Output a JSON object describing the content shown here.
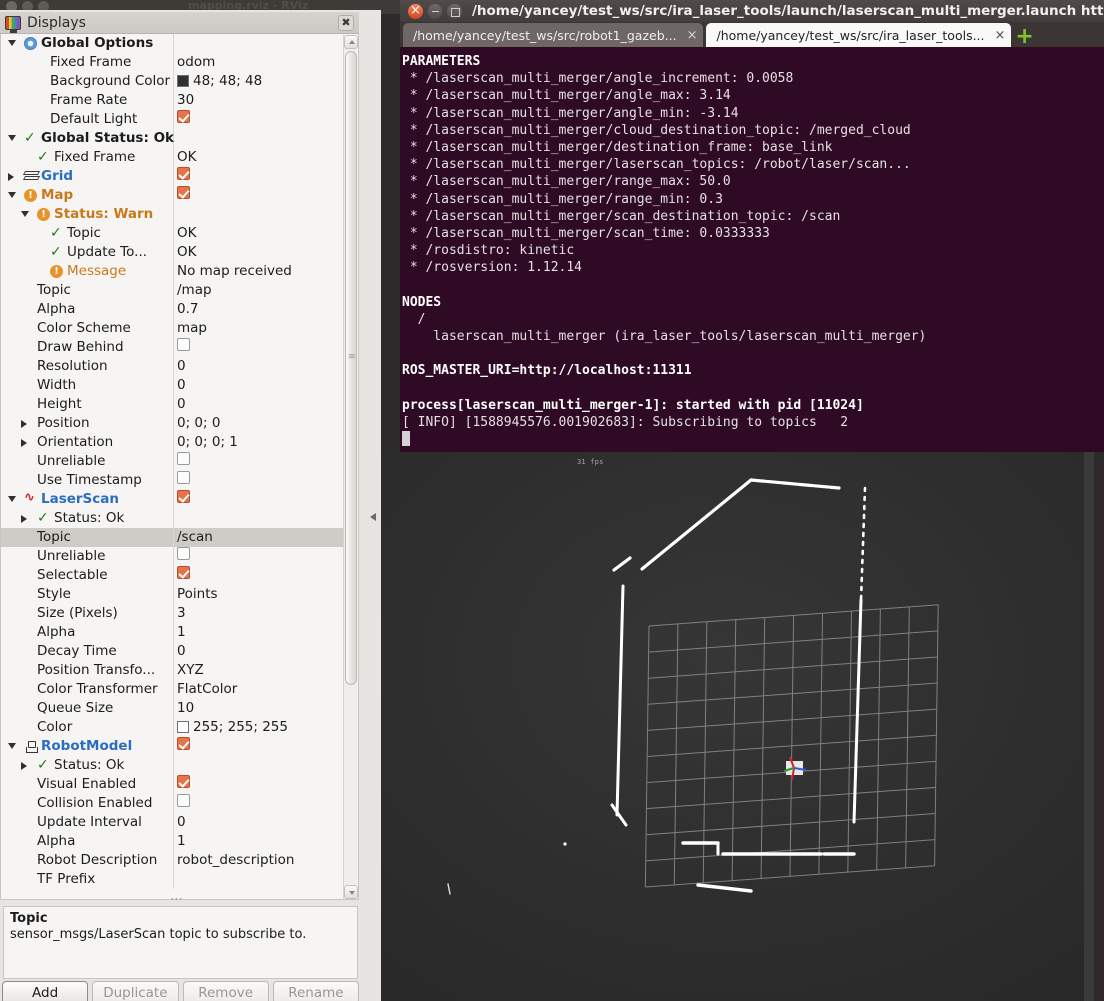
{
  "desktop": {
    "rviz_window_title": "mapping.rviz - RViz"
  },
  "rviz": {
    "dock": {
      "title": "Displays",
      "icon": "displays-icon",
      "close_label": "✖"
    },
    "tree_rows": [
      {
        "indent": 1,
        "arrow": "down",
        "icon": "gear",
        "name": "Global Options",
        "value": "",
        "bold": true,
        "color": "normal"
      },
      {
        "indent": 3,
        "arrow": "",
        "icon": "",
        "name": "Fixed Frame",
        "value": "odom",
        "bold": false,
        "color": "normal"
      },
      {
        "indent": 3,
        "arrow": "",
        "icon": "",
        "name": "Background Color",
        "value": "48; 48; 48",
        "bold": false,
        "color": "normal",
        "swatch": "dark"
      },
      {
        "indent": 3,
        "arrow": "",
        "icon": "",
        "name": "Frame Rate",
        "value": "30",
        "bold": false,
        "color": "normal"
      },
      {
        "indent": 3,
        "arrow": "",
        "icon": "",
        "name": "Default Light",
        "value": "",
        "bold": false,
        "color": "normal",
        "check": "on"
      },
      {
        "indent": 1,
        "arrow": "down",
        "icon": "tick",
        "name": "Global Status: Ok",
        "value": "",
        "bold": true,
        "color": "normal"
      },
      {
        "indent": 2,
        "arrow": "",
        "icon": "tick",
        "name": "Fixed Frame",
        "value": "OK",
        "bold": false,
        "color": "normal"
      },
      {
        "indent": 1,
        "arrow": "right",
        "icon": "grid",
        "name": "Grid",
        "value": "",
        "bold": true,
        "color": "blue",
        "check": "on"
      },
      {
        "indent": 1,
        "arrow": "down",
        "icon": "warn",
        "name": "Map",
        "value": "",
        "bold": true,
        "color": "orange",
        "check": "on"
      },
      {
        "indent": 2,
        "arrow": "down",
        "icon": "warn",
        "name": "Status: Warn",
        "value": "",
        "bold": false,
        "color": "orange"
      },
      {
        "indent": 3,
        "arrow": "",
        "icon": "tick",
        "name": "Topic",
        "value": "OK",
        "bold": false,
        "color": "normal"
      },
      {
        "indent": 3,
        "arrow": "",
        "icon": "tick",
        "name": "Update To...",
        "value": "OK",
        "bold": false,
        "color": "normal"
      },
      {
        "indent": 3,
        "arrow": "",
        "icon": "warn",
        "name": "Message",
        "value": "No map received",
        "bold": false,
        "color": "orangeN"
      },
      {
        "indent": 2,
        "arrow": "",
        "icon": "",
        "name": "Topic",
        "value": "/map",
        "bold": false,
        "color": "normal"
      },
      {
        "indent": 2,
        "arrow": "",
        "icon": "",
        "name": "Alpha",
        "value": "0.7",
        "bold": false,
        "color": "normal"
      },
      {
        "indent": 2,
        "arrow": "",
        "icon": "",
        "name": "Color Scheme",
        "value": "map",
        "bold": false,
        "color": "normal"
      },
      {
        "indent": 2,
        "arrow": "",
        "icon": "",
        "name": "Draw Behind",
        "value": "",
        "bold": false,
        "color": "normal",
        "check": "off"
      },
      {
        "indent": 2,
        "arrow": "",
        "icon": "",
        "name": "Resolution",
        "value": "0",
        "bold": false,
        "color": "normal"
      },
      {
        "indent": 2,
        "arrow": "",
        "icon": "",
        "name": "Width",
        "value": "0",
        "bold": false,
        "color": "normal"
      },
      {
        "indent": 2,
        "arrow": "",
        "icon": "",
        "name": "Height",
        "value": "0",
        "bold": false,
        "color": "normal"
      },
      {
        "indent": 2,
        "arrow": "right",
        "icon": "",
        "name": "Position",
        "value": "0; 0; 0",
        "bold": false,
        "color": "normal"
      },
      {
        "indent": 2,
        "arrow": "right",
        "icon": "",
        "name": "Orientation",
        "value": "0; 0; 0; 1",
        "bold": false,
        "color": "normal"
      },
      {
        "indent": 2,
        "arrow": "",
        "icon": "",
        "name": "Unreliable",
        "value": "",
        "bold": false,
        "color": "normal",
        "check": "off"
      },
      {
        "indent": 2,
        "arrow": "",
        "icon": "",
        "name": "Use Timestamp",
        "value": "",
        "bold": false,
        "color": "normal",
        "check": "off"
      },
      {
        "indent": 1,
        "arrow": "down",
        "icon": "laser",
        "name": "LaserScan",
        "value": "",
        "bold": true,
        "color": "blue",
        "check": "on"
      },
      {
        "indent": 2,
        "arrow": "right",
        "icon": "tick",
        "name": "Status: Ok",
        "value": "",
        "bold": false,
        "color": "normal"
      },
      {
        "indent": 2,
        "arrow": "",
        "icon": "",
        "name": "Topic",
        "value": "/scan",
        "bold": false,
        "color": "normal",
        "selected": true
      },
      {
        "indent": 2,
        "arrow": "",
        "icon": "",
        "name": "Unreliable",
        "value": "",
        "bold": false,
        "color": "normal",
        "check": "off"
      },
      {
        "indent": 2,
        "arrow": "",
        "icon": "",
        "name": "Selectable",
        "value": "",
        "bold": false,
        "color": "normal",
        "check": "on"
      },
      {
        "indent": 2,
        "arrow": "",
        "icon": "",
        "name": "Style",
        "value": "Points",
        "bold": false,
        "color": "normal"
      },
      {
        "indent": 2,
        "arrow": "",
        "icon": "",
        "name": "Size (Pixels)",
        "value": "3",
        "bold": false,
        "color": "normal"
      },
      {
        "indent": 2,
        "arrow": "",
        "icon": "",
        "name": "Alpha",
        "value": "1",
        "bold": false,
        "color": "normal"
      },
      {
        "indent": 2,
        "arrow": "",
        "icon": "",
        "name": "Decay Time",
        "value": "0",
        "bold": false,
        "color": "normal"
      },
      {
        "indent": 2,
        "arrow": "",
        "icon": "",
        "name": "Position Transfo...",
        "value": "XYZ",
        "bold": false,
        "color": "normal"
      },
      {
        "indent": 2,
        "arrow": "",
        "icon": "",
        "name": "Color Transformer",
        "value": "FlatColor",
        "bold": false,
        "color": "normal"
      },
      {
        "indent": 2,
        "arrow": "",
        "icon": "",
        "name": "Queue Size",
        "value": "10",
        "bold": false,
        "color": "normal"
      },
      {
        "indent": 2,
        "arrow": "",
        "icon": "",
        "name": "Color",
        "value": "255; 255; 255",
        "bold": false,
        "color": "normal",
        "swatch": "white"
      },
      {
        "indent": 1,
        "arrow": "down",
        "icon": "robot",
        "name": "RobotModel",
        "value": "",
        "bold": true,
        "color": "blue",
        "check": "on"
      },
      {
        "indent": 2,
        "arrow": "right",
        "icon": "tick",
        "name": "Status: Ok",
        "value": "",
        "bold": false,
        "color": "normal"
      },
      {
        "indent": 2,
        "arrow": "",
        "icon": "",
        "name": "Visual Enabled",
        "value": "",
        "bold": false,
        "color": "normal",
        "check": "on"
      },
      {
        "indent": 2,
        "arrow": "",
        "icon": "",
        "name": "Collision Enabled",
        "value": "",
        "bold": false,
        "color": "normal",
        "check": "off"
      },
      {
        "indent": 2,
        "arrow": "",
        "icon": "",
        "name": "Update Interval",
        "value": "0",
        "bold": false,
        "color": "normal"
      },
      {
        "indent": 2,
        "arrow": "",
        "icon": "",
        "name": "Alpha",
        "value": "1",
        "bold": false,
        "color": "normal"
      },
      {
        "indent": 2,
        "arrow": "",
        "icon": "",
        "name": "Robot Description",
        "value": "robot_description",
        "bold": false,
        "color": "normal"
      },
      {
        "indent": 2,
        "arrow": "",
        "icon": "",
        "name": "TF Prefix",
        "value": "",
        "bold": false,
        "color": "normal"
      }
    ],
    "description": {
      "title": "Topic",
      "body": "sensor_msgs/LaserScan topic to subscribe to."
    },
    "buttons": [
      {
        "label": "Add",
        "enabled": true
      },
      {
        "label": "Duplicate",
        "enabled": false
      },
      {
        "label": "Remove",
        "enabled": false
      },
      {
        "label": "Rename",
        "enabled": false
      }
    ]
  },
  "viewport": {
    "fps_overlay": "31 fps",
    "background_color": "#2e2e2e",
    "grid_color": "#9a9a9a",
    "points_color": "#ffffff"
  },
  "terminal": {
    "title": "/home/yancey/test_ws/src/ira_laser_tools/launch/laserscan_multi_merger.launch http:",
    "tabs": [
      {
        "label": "/home/yancey/test_ws/src/robot1_gazeb...",
        "active": false,
        "close": "×"
      },
      {
        "label": "/home/yancey/test_ws/src/ira_laser_tools...",
        "active": true,
        "close": "×"
      }
    ],
    "new_tab_label": "+",
    "lines": [
      {
        "text": "PARAMETERS",
        "bold": true
      },
      {
        "text": " * /laserscan_multi_merger/angle_increment: 0.0058",
        "bold": false
      },
      {
        "text": " * /laserscan_multi_merger/angle_max: 3.14",
        "bold": false
      },
      {
        "text": " * /laserscan_multi_merger/angle_min: -3.14",
        "bold": false
      },
      {
        "text": " * /laserscan_multi_merger/cloud_destination_topic: /merged_cloud",
        "bold": false
      },
      {
        "text": " * /laserscan_multi_merger/destination_frame: base_link",
        "bold": false
      },
      {
        "text": " * /laserscan_multi_merger/laserscan_topics: /robot/laser/scan...",
        "bold": false
      },
      {
        "text": " * /laserscan_multi_merger/range_max: 50.0",
        "bold": false
      },
      {
        "text": " * /laserscan_multi_merger/range_min: 0.3",
        "bold": false
      },
      {
        "text": " * /laserscan_multi_merger/scan_destination_topic: /scan",
        "bold": false
      },
      {
        "text": " * /laserscan_multi_merger/scan_time: 0.0333333",
        "bold": false
      },
      {
        "text": " * /rosdistro: kinetic",
        "bold": false
      },
      {
        "text": " * /rosversion: 1.12.14",
        "bold": false
      },
      {
        "text": "",
        "bold": false
      },
      {
        "text": "NODES",
        "bold": true
      },
      {
        "text": "  /",
        "bold": false
      },
      {
        "text": "    laserscan_multi_merger (ira_laser_tools/laserscan_multi_merger)",
        "bold": false
      },
      {
        "text": "",
        "bold": false
      },
      {
        "text": "ROS_MASTER_URI=http://localhost:11311",
        "bold": true
      },
      {
        "text": "",
        "bold": false
      },
      {
        "text": "process[laserscan_multi_merger-1]: started with pid [11024]",
        "bold": true
      },
      {
        "text": "[ INFO] [1588945576.001902683]: Subscribing to topics\t2",
        "bold": false
      }
    ]
  }
}
